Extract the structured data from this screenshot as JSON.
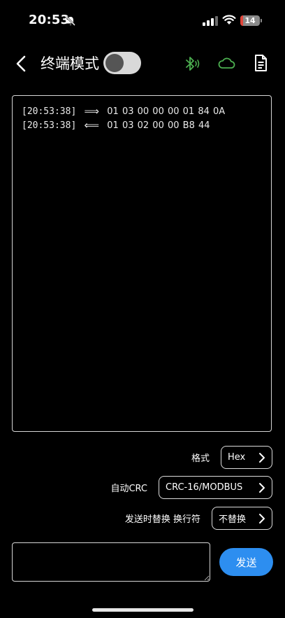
{
  "status_bar": {
    "time": "20:53",
    "battery_text": "14",
    "battery_level": 0.14,
    "icons": [
      "silent-bell-icon",
      "signal-icon",
      "wifi-icon",
      "battery-icon"
    ]
  },
  "nav": {
    "title": "终端模式",
    "terminal_mode_enabled": false,
    "icons": [
      "back-chevron-icon",
      "bluetooth-icon",
      "cloud-icon",
      "document-icon"
    ],
    "colors": {
      "bluetooth": "#4caf50",
      "cloud": "#4caf50"
    }
  },
  "terminal": {
    "lines": [
      {
        "time": "[20:53:38]",
        "direction": "⟹",
        "data": "01 03 00 00 00 01 84 0A"
      },
      {
        "time": "[20:53:38]",
        "direction": "⟸",
        "data": "01 03 02 00 00 B8 44"
      }
    ]
  },
  "settings": {
    "format": {
      "label": "格式",
      "value": "Hex"
    },
    "auto_crc": {
      "label": "自动CRC",
      "value": "CRC-16/MODBUS"
    },
    "newline": {
      "label": "发送时替换 换行符",
      "value": "不替换"
    }
  },
  "send": {
    "input_value": "",
    "button_label": "发送",
    "button_color": "#2d8ef0"
  }
}
